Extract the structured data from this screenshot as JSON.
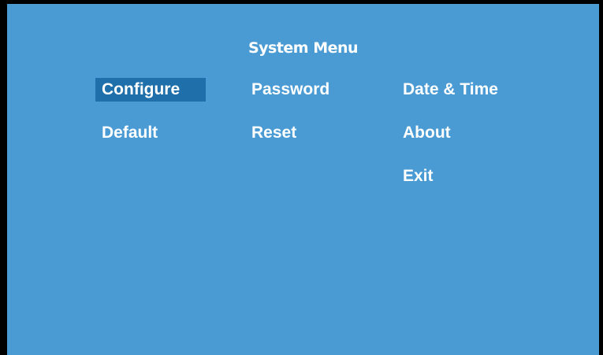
{
  "window": {
    "title": "System Menu"
  },
  "menu": {
    "selected": "Configure",
    "items": [
      {
        "label": "Configure"
      },
      {
        "label": "Password"
      },
      {
        "label": "Date & Time"
      },
      {
        "label": "Default"
      },
      {
        "label": "Reset"
      },
      {
        "label": "About"
      },
      {
        "label": "Exit"
      }
    ]
  },
  "colors": {
    "background": "#4a9bd4",
    "highlight": "#1f6fab",
    "text": "#ffffff",
    "frame": "#000000"
  }
}
